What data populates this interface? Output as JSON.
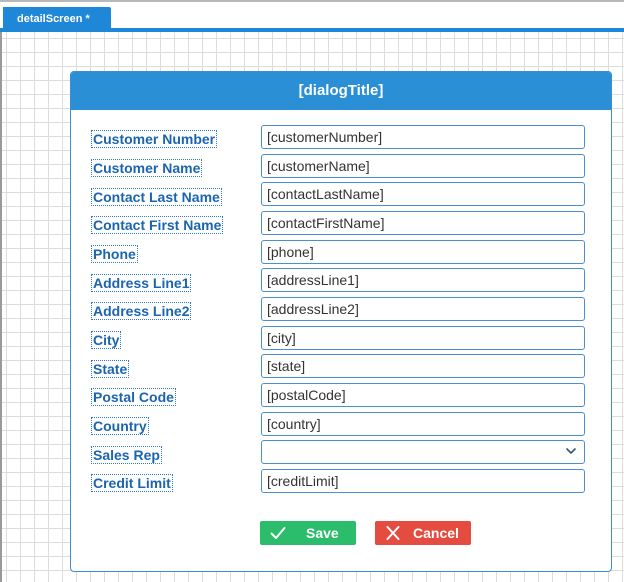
{
  "tab": {
    "label": "detailScreen *"
  },
  "dialog": {
    "title": "[dialogTitle]",
    "fields": [
      {
        "label": "Customer Number",
        "value": "[customerNumber]"
      },
      {
        "label": "Customer Name",
        "value": "[customerName]"
      },
      {
        "label": "Contact Last Name",
        "value": "[contactLastName]"
      },
      {
        "label": "Contact First Name",
        "value": "[contactFirstName]"
      },
      {
        "label": "Phone",
        "value": "[phone]"
      },
      {
        "label": "Address Line1",
        "value": "[addressLine1]"
      },
      {
        "label": "Address Line2",
        "value": "[addressLine2]"
      },
      {
        "label": "City",
        "value": "[city]"
      },
      {
        "label": "State",
        "value": "[state]"
      },
      {
        "label": "Postal Code",
        "value": "[postalCode]"
      },
      {
        "label": "Country",
        "value": "[country]"
      },
      {
        "label": "Sales Rep",
        "value": ""
      },
      {
        "label": "Credit Limit",
        "value": "[creditLimit]"
      }
    ],
    "buttons": {
      "save_label": "Save",
      "save_icon": "check-icon",
      "cancel_label": "Cancel",
      "cancel_icon": "close-icon"
    }
  },
  "colors": {
    "accent": "#1e87d8",
    "header": "#2b8fd6",
    "label_text": "#1a64b0",
    "save": "#2bbd6c",
    "cancel": "#e34c3f"
  }
}
